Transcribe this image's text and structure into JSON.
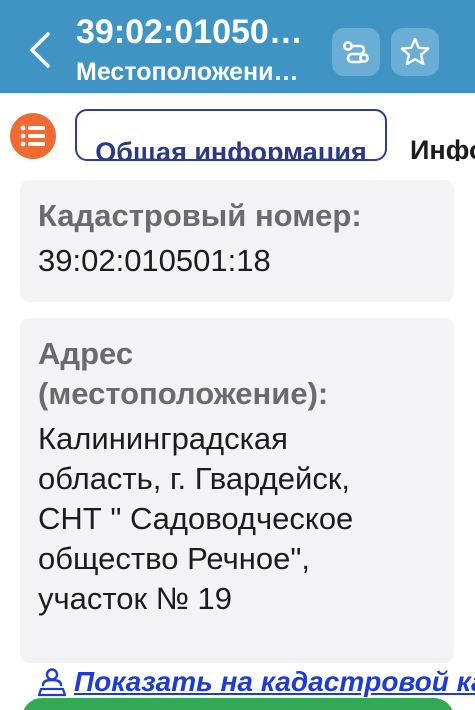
{
  "header": {
    "title": "39:02:01050…",
    "subtitle": "Местоположени…"
  },
  "tabs": {
    "active_label": "Общая информация",
    "next_label": "Инфо"
  },
  "cadastral": {
    "label": "Кадастровый номер:",
    "value": "39:02:010501:18"
  },
  "address": {
    "label_line1": "Адрес",
    "label_line2": "(местоположение):",
    "lines": [
      "Калининградская",
      "область, г. Гвардейск,",
      "СНТ \" Садоводческое",
      "общество Речное\",",
      "участок № 19"
    ]
  },
  "map_link": {
    "label": "Показать на кадастровой карте"
  },
  "colors": {
    "header_bg": "#3f94c4",
    "header_button_bg": "#6aaed6",
    "menu_button_bg": "#f06b34",
    "active_tab_border": "#2f3d8c",
    "card_bg": "#f3f3f5",
    "link": "#1f3bd1",
    "bottom_button": "#35a853"
  },
  "icons": {
    "back": "chevron-left-icon",
    "share": "route-icon",
    "favorite": "star-outline-icon",
    "menu": "list-icon",
    "map": "person-pin-icon"
  }
}
